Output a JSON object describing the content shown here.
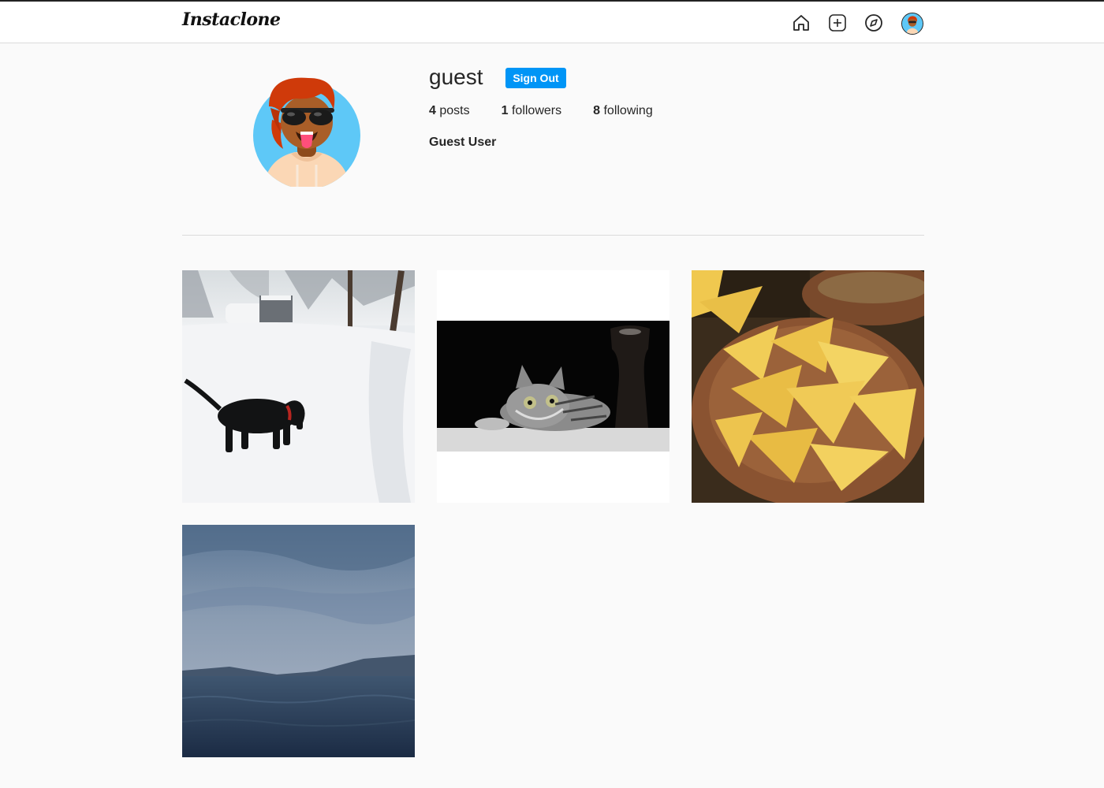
{
  "app": {
    "logo": "Instaclone"
  },
  "nav": {
    "icons": [
      "home-icon",
      "new-post-icon",
      "explore-icon",
      "avatar"
    ]
  },
  "profile": {
    "username": "guest",
    "sign_out_label": "Sign Out",
    "posts_count": "4",
    "posts_label": "posts",
    "followers_count": "1",
    "followers_label": "followers",
    "following_count": "8",
    "following_label": "following",
    "full_name": "Guest User"
  },
  "posts": [
    {
      "subject": "dog in snow"
    },
    {
      "subject": "tabby cat lying down"
    },
    {
      "subject": "tortilla chips in bowl"
    },
    {
      "subject": "stormy sea"
    }
  ],
  "colors": {
    "accent": "#0095f6",
    "background": "#fafafa",
    "text": "#262626"
  }
}
